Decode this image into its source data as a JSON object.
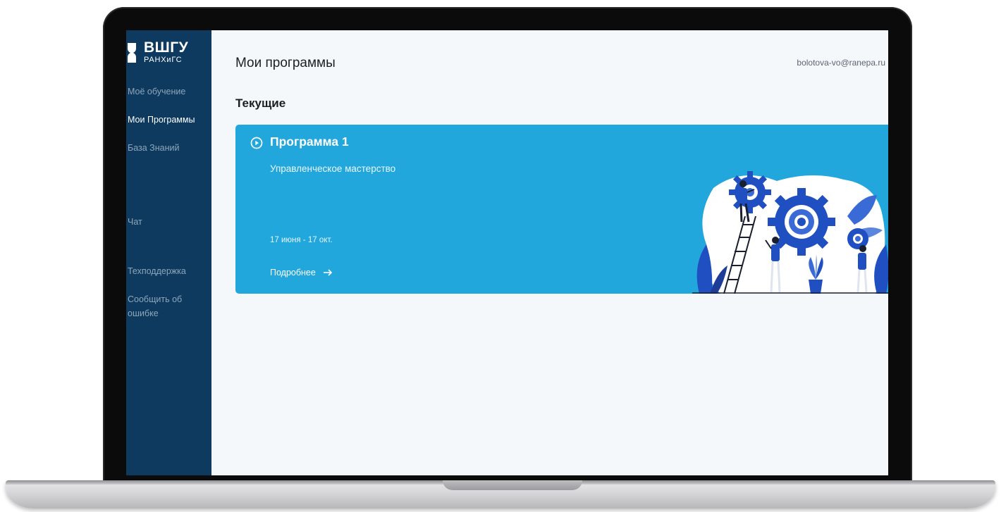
{
  "brand": {
    "name": "ВШГУ",
    "sub": "РАНХиГС"
  },
  "sidebar": {
    "items": [
      {
        "label": "Моё обучение",
        "active": false
      },
      {
        "label": "Мои Программы",
        "active": true
      },
      {
        "label": "База Знаний",
        "active": false
      },
      {
        "label": "Чат",
        "active": false
      },
      {
        "label": "Техподдержка",
        "active": false
      },
      {
        "label": "Сообщить об ошибке",
        "active": false
      }
    ]
  },
  "header": {
    "title": "Мои программы",
    "user_email": "bolotova-vo@ranepa.ru"
  },
  "section": {
    "title": "Текущие"
  },
  "program_card": {
    "title": "Программа 1",
    "subtitle": "Управленческое мастерство",
    "dates": "17 июня - 17 окт.",
    "more_label": "Подробнее",
    "icon": "play-circle-icon",
    "illustration": "gears-team-illustration"
  },
  "colors": {
    "sidebar_bg": "#0d3a5e",
    "card_bg": "#22a7dd",
    "page_bg": "#f5f8fb",
    "illustration_blue": "#1f4fc1"
  }
}
